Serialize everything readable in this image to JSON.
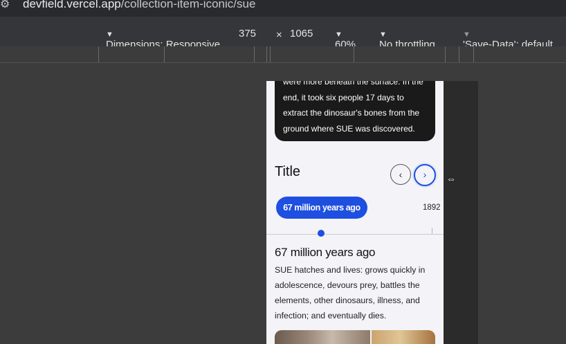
{
  "browser": {
    "url_host": "devfield.vercel.app",
    "url_path": "/collection-item-iconic/sue"
  },
  "device_toolbar": {
    "dimensions_label": "Dimensions: Responsive",
    "width": "375",
    "times": "×",
    "height": "1065",
    "zoom": "60%",
    "throttling": "No throttling",
    "save_data": "'Save-Data': default",
    "caret": "▼"
  },
  "page": {
    "card_text": "were more beneath the surface. In the end, it took six people 17 days to extract the dinosaur's bones from the ground where SUE was discovered.",
    "section_title": "Title",
    "prev_arrow": "‹",
    "next_arrow": "›",
    "active_pill": "67 million years ago",
    "next_year": "1892",
    "detail_heading": "67 million years ago",
    "detail_body": "SUE hatches and lives: grows quickly in adolescence, devours prey, battles the elements, other dinosaurs, illness, and infection; and eventually dies."
  },
  "cursor_glyph": "⇔",
  "colors": {
    "accent": "#1e4fe0",
    "card": "#1a1a1a",
    "page_bg": "#f3f3f8"
  }
}
